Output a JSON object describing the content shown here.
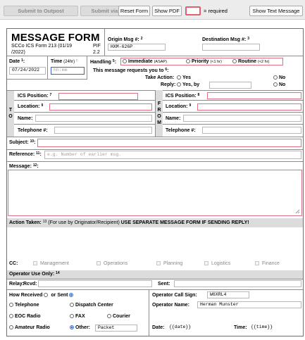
{
  "toolbar": {
    "submit_outpost": "Submit to Outpost",
    "submit_email": "Submit via Email",
    "reset_form": "Reset Form",
    "show_pdf": "Show PDF",
    "required_legend": "= required",
    "show_text_message": "Show Text Message"
  },
  "header": {
    "title": "MESSAGE FORM",
    "subtitle_line1": "SCCo ICS Form 213 (01/19",
    "subtitle_line2": "/2022)",
    "pif_label": "PIF",
    "pif_value": "2.2",
    "origin_msg_label": "Origin Msg #:",
    "origin_msg_sup": "2",
    "origin_msg_value": "HXM-626P",
    "destination_msg_label": "Destination Msg #:",
    "destination_msg_sup": "3"
  },
  "date": {
    "label": "Date",
    "sup": "1",
    "value": "07/24/2022"
  },
  "time": {
    "label": "Time",
    "suffix": "(24hr)",
    "sup": ":",
    "placeholder": "hh:mm"
  },
  "handling": {
    "label": "Handling",
    "sup": "5",
    "immediate": "Immediate",
    "immediate_note": "(ASAP)",
    "priority": "Priority",
    "priority_note": "(<1 hr)",
    "routine": "Routine",
    "routine_note": "(<2 hr)"
  },
  "requests": {
    "label": "This message requests you to",
    "sup": "6",
    "take_action_label": "Take Action:",
    "yes": "Yes",
    "no": "No",
    "reply_label": "Reply:",
    "yes_by": "Yes, by"
  },
  "to": {
    "side_label": "T O",
    "ics_position_label": "ICS Position:",
    "ics_sup": "7",
    "location_label": "Location:",
    "location_sup": "9",
    "name_label": "Name:",
    "telephone_label": "Telephone #:"
  },
  "from": {
    "side_label": "F R O M",
    "ics_position_label": "ICS Position:",
    "ics_sup": "8",
    "location_label": "Location:",
    "location_sup": "9",
    "name_label": "Name:",
    "telephone_label": "Telephone #:"
  },
  "subject": {
    "label": "Subject:",
    "sup": "10"
  },
  "reference": {
    "label": "Reference:",
    "sup": "11",
    "placeholder": "e.g. Number of earlier msg."
  },
  "message": {
    "label": "Message:",
    "sup": "12"
  },
  "action_taken": {
    "label": "Action Taken:",
    "sup": "13",
    "note": "(For use by Originator/Recipient)",
    "warning": "USE SEPARATE MESSAGE FORM IF SENDING REPLY!"
  },
  "cc": {
    "label": "CC:",
    "options": [
      "Management",
      "Operations",
      "Planning",
      "Logistics",
      "Finance"
    ]
  },
  "operator": {
    "label": "Operator Use Only:",
    "sup": "14",
    "relay_label": "Relay:",
    "rcvd_label": "Rcvd:",
    "sent_label": "Sent:",
    "how_label": "How Received",
    "or_sent_label": "or Sent",
    "telephone": "Telephone",
    "dispatch_center": "Dispatch Center",
    "eoc_radio": "EOC Radio",
    "fax": "FAX",
    "courier": "Courier",
    "amateur_radio": "Amateur Radio",
    "other_label": "Other:",
    "other_value": "Packet",
    "call_sign_label": "Operator Call Sign:",
    "call_sign_value": "W6XRL4",
    "operator_name_label": "Operator Name:",
    "operator_name_value": "Herman Munster",
    "date_label": "Date:",
    "date_value": "{{date}}",
    "time_label": "Time:",
    "time_value": "{{time}}"
  },
  "colors": {
    "required_border": "#e07080",
    "focus_border": "#3b5fd0",
    "selected_radio": "#3a6fd8",
    "toolbar_bg": "#ececec",
    "section_band": "#dcdcdc"
  }
}
